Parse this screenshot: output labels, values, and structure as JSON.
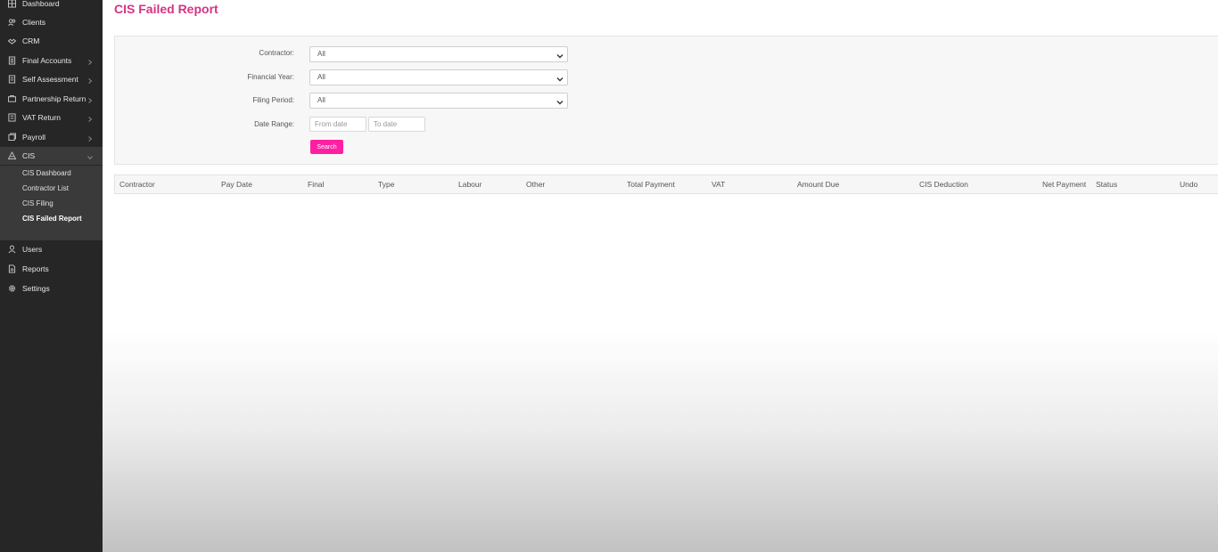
{
  "sidebar": {
    "items": [
      {
        "label": "Dashboard",
        "icon": "dashboard-icon"
      },
      {
        "label": "Clients",
        "icon": "clients-icon"
      },
      {
        "label": "CRM",
        "icon": "crm-icon"
      },
      {
        "label": "Final Accounts",
        "icon": "final-accounts-icon"
      },
      {
        "label": "Self Assessment",
        "icon": "self-assessment-icon"
      },
      {
        "label": "Partnership Return",
        "icon": "partnership-icon"
      },
      {
        "label": "VAT Return",
        "icon": "vat-return-icon"
      },
      {
        "label": "Payroll",
        "icon": "payroll-icon"
      },
      {
        "label": "CIS",
        "icon": "cis-icon"
      },
      {
        "label": "Users",
        "icon": "users-icon"
      },
      {
        "label": "Reports",
        "icon": "reports-icon"
      },
      {
        "label": "Settings",
        "icon": "settings-icon"
      }
    ],
    "cis_submenu": [
      "CIS Dashboard",
      "Contractor List",
      "CIS Filing",
      "CIS Failed Report"
    ],
    "active_submenu": "CIS Failed Report"
  },
  "page": {
    "title": "CIS Failed Report"
  },
  "filters": {
    "contractor": {
      "label": "Contractor:",
      "value": "All"
    },
    "financial_year": {
      "label": "Financial Year:",
      "value": "All"
    },
    "filing_period": {
      "label": "Filing Period:",
      "value": "All"
    },
    "date_range": {
      "label": "Date Range:",
      "from_placeholder": "From date",
      "to_placeholder": "To date"
    },
    "search_label": "Search"
  },
  "table": {
    "columns": [
      "Contractor",
      "Pay Date",
      "Final",
      "Type",
      "Labour",
      "Other",
      "Total Payment",
      "VAT",
      "Amount Due",
      "CIS Deduction",
      "Net Payment",
      "Status",
      "Undo"
    ]
  },
  "colors": {
    "accent": "#d63384",
    "button": "#ff1fa3",
    "sidebar_bg": "#262626"
  }
}
